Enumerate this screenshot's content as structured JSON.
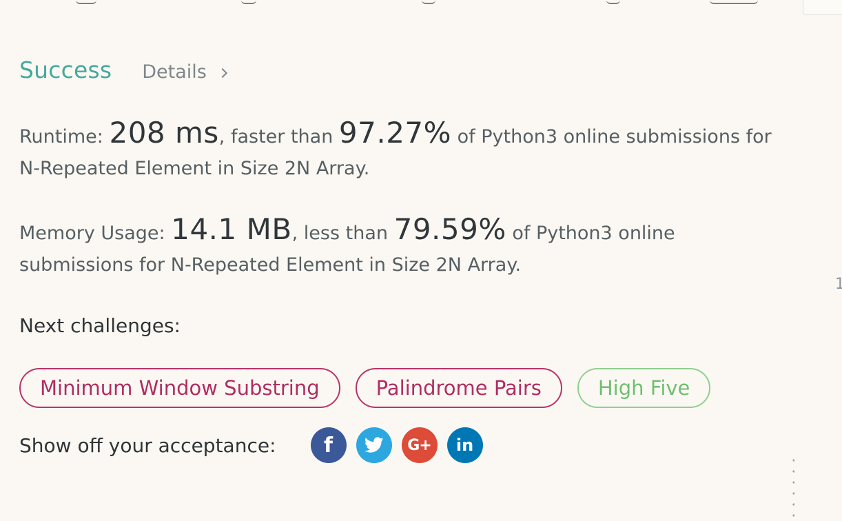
{
  "status": {
    "result": "Success",
    "details_label": "Details"
  },
  "runtime": {
    "label": "Runtime:",
    "value": "208 ms",
    "comparison": ", faster than",
    "percent": "97.27%",
    "suffix": "of Python3 online submissions for N-Repeated Element in Size 2N Array."
  },
  "memory": {
    "label": "Memory Usage:",
    "value": "14.1 MB",
    "comparison": ", less than",
    "percent": "79.59%",
    "suffix": "of Python3 online submissions for N-Repeated Element in Size 2N Array."
  },
  "next": {
    "label": "Next challenges:",
    "challenges": [
      {
        "label": "Minimum Window Substring",
        "difficulty": "hard",
        "color": "#b93368"
      },
      {
        "label": "Palindrome Pairs",
        "difficulty": "hard",
        "color": "#b93368"
      },
      {
        "label": "High Five",
        "difficulty": "easy",
        "color": "#8fcf90"
      }
    ]
  },
  "share": {
    "label": "Show off your acceptance:",
    "icons": [
      {
        "name": "facebook-icon",
        "glyph": "f",
        "color": "#3b5998"
      },
      {
        "name": "twitter-icon",
        "glyph": "",
        "color": "#2ca7e0"
      },
      {
        "name": "google-plus-icon",
        "glyph": "G+",
        "color": "#dd4b39"
      },
      {
        "name": "linkedin-icon",
        "glyph": "in",
        "color": "#0077b5"
      }
    ]
  },
  "edge": {
    "right_number": "1"
  },
  "colors": {
    "success": "#45a89c",
    "background": "#fbf8f3"
  }
}
